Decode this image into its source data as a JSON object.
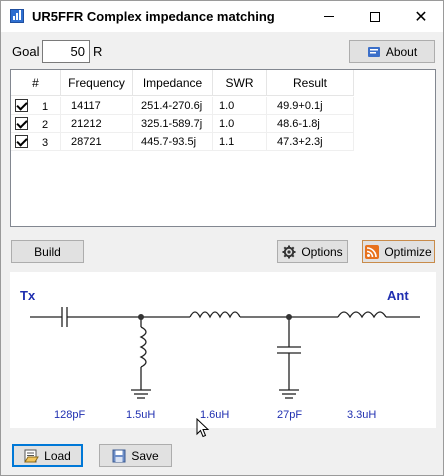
{
  "window": {
    "title": "UR5FFR Complex impedance matching",
    "minimize_glyph": "",
    "close_glyph": "✕"
  },
  "goal": {
    "label": "Goal",
    "value": "50",
    "unit": "R"
  },
  "buttons": {
    "about": "About",
    "build": "Build",
    "options": "Options",
    "optimize": "Optimize",
    "load": "Load",
    "save": "Save"
  },
  "table": {
    "headers": [
      "#",
      "Frequency",
      "Impedance",
      "SWR",
      "Result"
    ],
    "rows": [
      {
        "checked": true,
        "index": "1",
        "frequency": "14117",
        "impedance": "251.4-270.6j",
        "swr": "1.0",
        "result": "49.9+0.1j"
      },
      {
        "checked": true,
        "index": "2",
        "frequency": "21212",
        "impedance": "325.1-589.7j",
        "swr": "1.0",
        "result": "48.6-1.8j"
      },
      {
        "checked": true,
        "index": "3",
        "frequency": "28721",
        "impedance": "445.7-93.5j",
        "swr": "1.1",
        "result": "47.3+2.3j"
      }
    ]
  },
  "circuit": {
    "tx_label": "Tx",
    "ant_label": "Ant",
    "component_values": [
      "128pF",
      "1.5uH",
      "1.6uH",
      "27pF",
      "3.3uH"
    ]
  },
  "colors": {
    "accent": "#0078d7",
    "circuit_label": "#1f2fb0",
    "optimize_icon": "#e8711c"
  },
  "icons": {
    "app": "app-icon",
    "about": "info-icon",
    "options": "gear-icon",
    "optimize": "rss-icon",
    "load": "folder-open-icon",
    "save": "save-icon"
  }
}
